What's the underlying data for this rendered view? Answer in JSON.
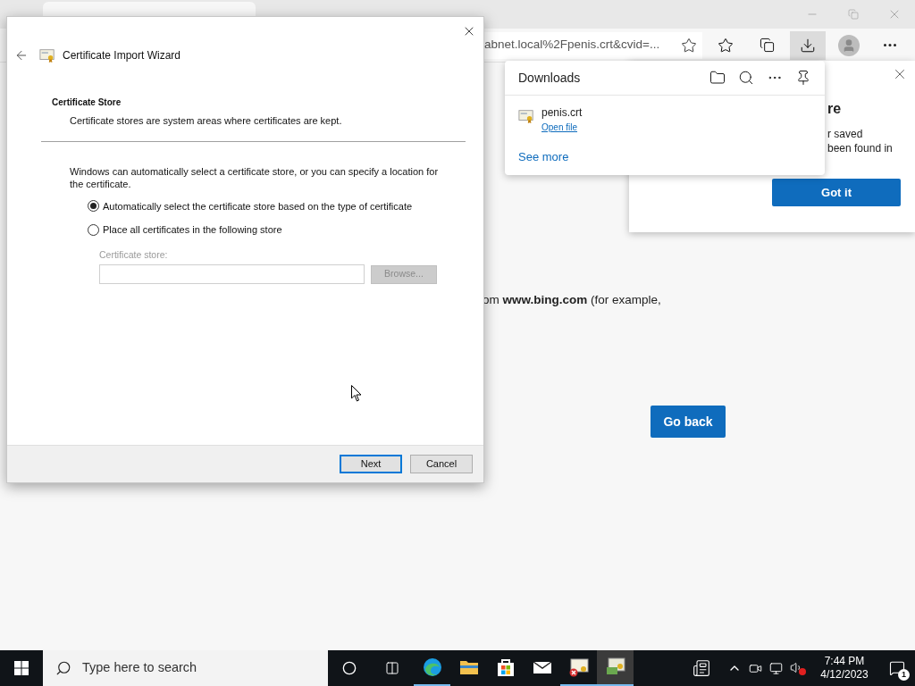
{
  "browser": {
    "address": "abnet.local%2Fpenis.crt&cvid=...",
    "page_text": "om **www.bing.com** (for example,",
    "go_back": "Go back"
  },
  "callout": {
    "heading": "re",
    "body_lines": [
      "r saved",
      "been found in"
    ],
    "button": "Got it"
  },
  "downloads": {
    "title": "Downloads",
    "items": [
      {
        "name": "penis.crt",
        "action": "Open file"
      }
    ],
    "see_more": "See more"
  },
  "dialog": {
    "title": "Certificate Import Wizard",
    "heading": "Certificate Store",
    "subheading": "Certificate stores are system areas where certificates are kept.",
    "intro": "Windows can automatically select a certificate store, or you can specify a location for the certificate.",
    "options": [
      {
        "label": "Automatically select the certificate store based on the type of certificate",
        "selected": true
      },
      {
        "label": "Place all certificates in the following store",
        "selected": false
      }
    ],
    "store_label": "Certificate store:",
    "browse": "Browse...",
    "buttons": [
      {
        "label": "Next",
        "default": true
      },
      {
        "label": "Cancel",
        "default": false
      }
    ]
  },
  "taskbar": {
    "search_placeholder": "Type here to search",
    "apps": [
      {
        "kind": "edge",
        "running": true,
        "selected": false
      },
      {
        "kind": "explorer",
        "running": false,
        "selected": false
      },
      {
        "kind": "store",
        "running": false,
        "selected": false
      },
      {
        "kind": "mail",
        "running": false,
        "selected": false
      },
      {
        "kind": "certificate",
        "running": true,
        "selected": false
      },
      {
        "kind": "wizard",
        "running": true,
        "selected": true
      }
    ],
    "time": "7:44 PM",
    "date": "4/12/2023",
    "notification_count": "1"
  }
}
